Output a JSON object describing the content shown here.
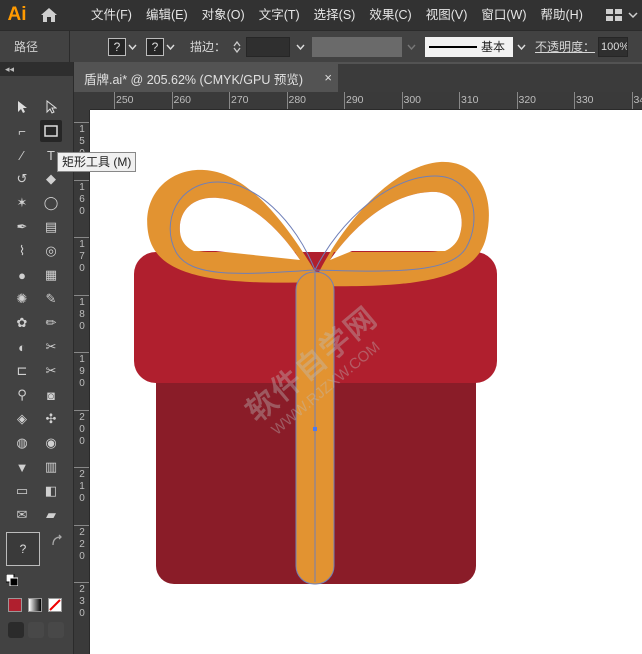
{
  "app": {
    "logo": "Ai"
  },
  "menu": {
    "items": [
      "文件(F)",
      "编辑(E)",
      "对象(O)",
      "文字(T)",
      "选择(S)",
      "效果(C)",
      "视图(V)",
      "窗口(W)",
      "帮助(H)"
    ]
  },
  "control_bar": {
    "selection_label": "路径",
    "fill_value": "?",
    "stroke_value": "?",
    "stroke_label": "描边：",
    "brush_label": "基本",
    "opacity_label": "不透明度：",
    "opacity_value": "100%"
  },
  "document_tab": {
    "title": "盾牌.ai* @ 205.62% (CMYK/GPU 预览)",
    "close": "×"
  },
  "tooltip": {
    "text": "矩形工具 (M)"
  },
  "ruler": {
    "top_labels": [
      "250",
      "260",
      "270",
      "280",
      "290",
      "300",
      "310",
      "320",
      "330",
      "34"
    ],
    "left_labels": [
      "150",
      "160",
      "170",
      "180",
      "190",
      "200",
      "210",
      "220",
      "230"
    ]
  },
  "watermark": {
    "line1": "软件自学网",
    "line2": "WWW.RJZXW.COM"
  },
  "colors": {
    "lid": "#b01f2e",
    "box": "#8a1c28",
    "ribbon": "#e29331",
    "path_outline": "#6f7fb8",
    "anchor": "#4d7bf0",
    "fill_swatch": "#b01f2e"
  },
  "toolbox": {
    "fill_stroke_value": "?",
    "tools": [
      "selection-icon",
      "direct-selection-icon",
      "pen-curvature-icon",
      "rectangle-icon",
      "brush-icon",
      "type-icon",
      "rotate-icon",
      "eraser-icon",
      "magic-wand-icon",
      "lasso-icon",
      "pen-icon",
      "gradient-icon",
      "eyedropper-icon",
      "spiral-icon",
      "blob-icon",
      "grid-icon",
      "symbol-sprayer-icon",
      "blend-icon",
      "puppet-warp-icon",
      "pencil-icon",
      "shape-builder-icon",
      "knife-icon",
      "crop-icon",
      "scissors-icon",
      "zoom-icon",
      "camera-icon",
      "live-paint-icon",
      "pattern-icon",
      "twirl-icon",
      "pucker-icon",
      "paint-bucket-icon",
      "chart-icon",
      "artboard-icon",
      "perspective-icon",
      "width-icon",
      "slice-icon"
    ]
  }
}
